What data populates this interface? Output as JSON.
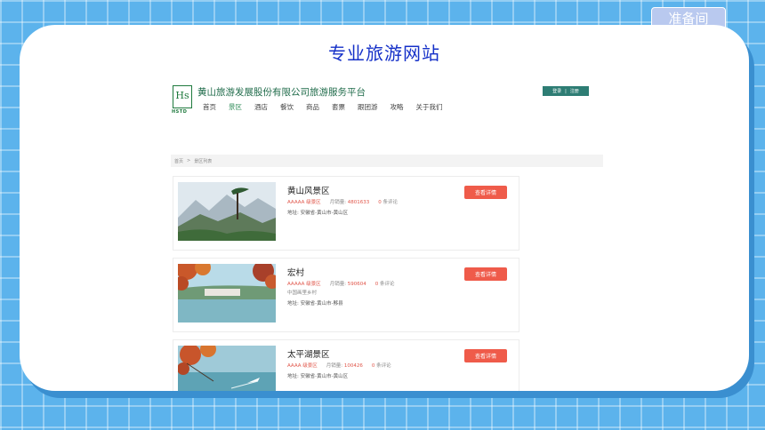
{
  "badge": "准备间",
  "slide_title": "专业旅游网站",
  "site": {
    "logo_mark": "Hs",
    "logo_sub": "HSTD",
    "company": "黄山旅游发展股份有限公司旅游服务平台",
    "auth": {
      "login": "登录",
      "sep": "|",
      "register": "注册"
    },
    "nav": [
      "首页",
      "景区",
      "酒店",
      "餐饮",
      "商品",
      "套票",
      "跟团游",
      "攻略",
      "关于我们"
    ],
    "nav_active_index": 1,
    "breadcrumb": {
      "home": "首页",
      "sep": ">",
      "current": "景区列表"
    },
    "button_label": "查看详情",
    "sales_label": "月销量:",
    "reviews_suffix": "条评论",
    "addr_label": "地址:",
    "items": [
      {
        "title": "黄山风景区",
        "grade": "AAAAA 级景区",
        "sales": "4801633",
        "reviews": "0",
        "extra": "",
        "address": "安徽省-黄山市-黄山区"
      },
      {
        "title": "宏村",
        "grade": "AAAAA 级景区",
        "sales": "590604",
        "reviews": "0",
        "extra": "中国画里乡村",
        "address": "安徽省-黄山市-黟县"
      },
      {
        "title": "太平湖景区",
        "grade": "AAAA 级景区",
        "sales": "100426",
        "reviews": "0",
        "extra": "",
        "address": "安徽省-黄山市-黄山区"
      }
    ]
  }
}
